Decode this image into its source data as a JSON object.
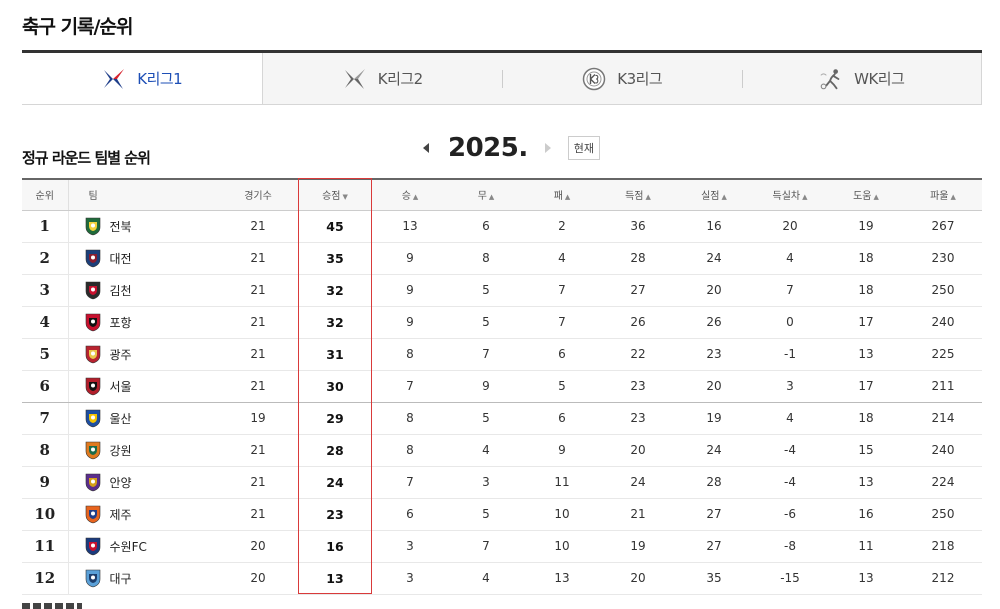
{
  "page": {
    "title": "축구 기록/순위"
  },
  "tabs": [
    {
      "label": "K리그1",
      "active": true,
      "logo": "k-league-1-icon"
    },
    {
      "label": "K리그2",
      "active": false,
      "logo": "k-league-2-icon"
    },
    {
      "label": "K3리그",
      "active": false,
      "logo": "k3-league-icon"
    },
    {
      "label": "WK리그",
      "active": false,
      "logo": "wk-league-icon"
    }
  ],
  "section": {
    "title": "정규 라운드 팀별 순위"
  },
  "season": {
    "year": "2025.",
    "current_label": "현재"
  },
  "table": {
    "headers": {
      "rank": "순위",
      "team": "팀",
      "played": "경기수",
      "points": "승점",
      "wins": "승",
      "draws": "무",
      "losses": "패",
      "gf": "득점",
      "ga": "실점",
      "gd": "득실차",
      "assists": "도움",
      "fouls": "파울"
    },
    "sort_indicator": "▲",
    "sort_active": "▼",
    "rows": [
      {
        "rank": "1",
        "team": "전북",
        "played": "21",
        "points": "45",
        "wins": "13",
        "draws": "6",
        "losses": "2",
        "gf": "36",
        "ga": "16",
        "gd": "20",
        "assists": "19",
        "fouls": "267",
        "color": "#1f6b3a",
        "accent": "#f3d23b"
      },
      {
        "rank": "2",
        "team": "대전",
        "played": "21",
        "points": "35",
        "wins": "9",
        "draws": "8",
        "losses": "4",
        "gf": "28",
        "ga": "24",
        "gd": "4",
        "assists": "18",
        "fouls": "230",
        "color": "#1c3f7a",
        "accent": "#8a1d2e"
      },
      {
        "rank": "3",
        "team": "김천",
        "played": "21",
        "points": "32",
        "wins": "9",
        "draws": "5",
        "losses": "7",
        "gf": "27",
        "ga": "20",
        "gd": "7",
        "assists": "18",
        "fouls": "250",
        "color": "#2b2b2b",
        "accent": "#c8102e"
      },
      {
        "rank": "4",
        "team": "포항",
        "played": "21",
        "points": "32",
        "wins": "9",
        "draws": "5",
        "losses": "7",
        "gf": "26",
        "ga": "26",
        "gd": "0",
        "assists": "17",
        "fouls": "240",
        "color": "#c8102e",
        "accent": "#111111"
      },
      {
        "rank": "5",
        "team": "광주",
        "played": "21",
        "points": "31",
        "wins": "8",
        "draws": "7",
        "losses": "6",
        "gf": "22",
        "ga": "23",
        "gd": "-1",
        "assists": "13",
        "fouls": "225",
        "color": "#b8232f",
        "accent": "#e8c84a"
      },
      {
        "rank": "6",
        "team": "서울",
        "played": "21",
        "points": "30",
        "wins": "7",
        "draws": "9",
        "losses": "5",
        "gf": "23",
        "ga": "20",
        "gd": "3",
        "assists": "17",
        "fouls": "211",
        "color": "#b21e2b",
        "accent": "#111111"
      },
      {
        "rank": "7",
        "team": "울산",
        "played": "19",
        "points": "29",
        "wins": "8",
        "draws": "5",
        "losses": "6",
        "gf": "23",
        "ga": "19",
        "gd": "4",
        "assists": "18",
        "fouls": "214",
        "color": "#1d4fa3",
        "accent": "#f2c200"
      },
      {
        "rank": "8",
        "team": "강원",
        "played": "21",
        "points": "28",
        "wins": "8",
        "draws": "4",
        "losses": "9",
        "gf": "20",
        "ga": "24",
        "gd": "-4",
        "assists": "15",
        "fouls": "240",
        "color": "#e07a1f",
        "accent": "#1b6b4a"
      },
      {
        "rank": "9",
        "team": "안양",
        "played": "21",
        "points": "24",
        "wins": "7",
        "draws": "3",
        "losses": "11",
        "gf": "24",
        "ga": "28",
        "gd": "-4",
        "assists": "13",
        "fouls": "224",
        "color": "#5a2d8c",
        "accent": "#d4a017"
      },
      {
        "rank": "10",
        "team": "제주",
        "played": "21",
        "points": "23",
        "wins": "6",
        "draws": "5",
        "losses": "10",
        "gf": "21",
        "ga": "27",
        "gd": "-6",
        "assists": "16",
        "fouls": "250",
        "color": "#e8641e",
        "accent": "#1f3e8a"
      },
      {
        "rank": "11",
        "team": "수원FC",
        "played": "20",
        "points": "16",
        "wins": "3",
        "draws": "7",
        "losses": "10",
        "gf": "19",
        "ga": "27",
        "gd": "-8",
        "assists": "11",
        "fouls": "218",
        "color": "#1b3b7d",
        "accent": "#c8102e"
      },
      {
        "rank": "12",
        "team": "대구",
        "played": "20",
        "points": "13",
        "wins": "3",
        "draws": "4",
        "losses": "13",
        "gf": "20",
        "ga": "35",
        "gd": "-15",
        "assists": "13",
        "fouls": "212",
        "color": "#5aa0d8",
        "accent": "#1d3d6b"
      }
    ]
  }
}
